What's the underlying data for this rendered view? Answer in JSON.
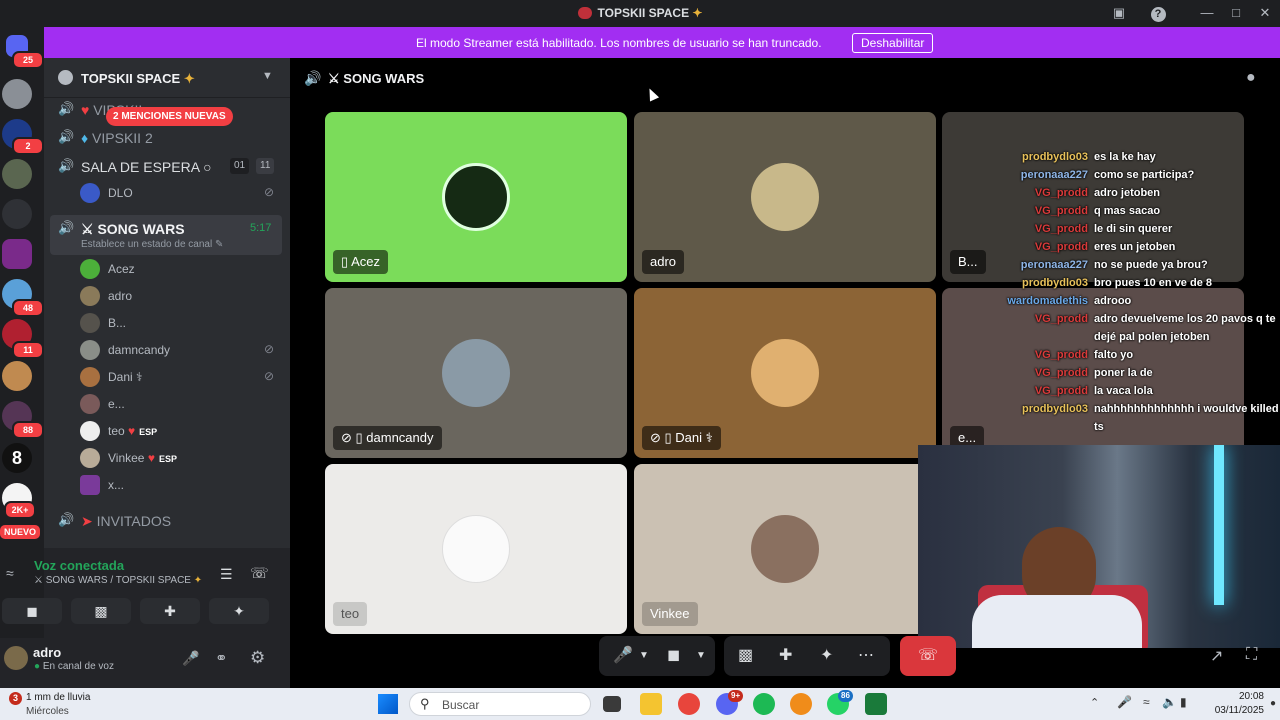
{
  "window": {
    "title": "TOPSKII SPACE"
  },
  "banner": {
    "text": "El modo Streamer está habilitado. Los nombres de usuario se han truncado.",
    "button": "Deshabilitar"
  },
  "rail": {
    "badges": [
      "25",
      "2",
      "48",
      "11",
      "88",
      "2K+",
      "NUEVO"
    ]
  },
  "guild": {
    "name": "TOPSKII SPACE"
  },
  "mentions": "2 MENCIONES NUEVAS",
  "channels": {
    "vips1": "VIPSKII",
    "vips2": "VIPSKII 2",
    "waiting": "SALA DE ESPERA",
    "waiting_counts": [
      "01",
      "11"
    ],
    "songwars": "SONG WARS",
    "songwars_timer": "5:17",
    "songwars_status": "Establece un estado de canal",
    "invitados": "INVITADOS"
  },
  "waiting_users": [
    "DLO"
  ],
  "members": [
    {
      "name": "Acez",
      "tag": "",
      "muted": false
    },
    {
      "name": "adro",
      "tag": "",
      "muted": false
    },
    {
      "name": "B...",
      "tag": "",
      "muted": false
    },
    {
      "name": "damncandy",
      "tag": "",
      "muted": true
    },
    {
      "name": "Dani ⚕",
      "tag": "",
      "muted": true
    },
    {
      "name": "e...",
      "tag": "",
      "muted": false
    },
    {
      "name": "teo",
      "tag": "ESP",
      "muted": false
    },
    {
      "name": "Vinkee",
      "tag": "ESP",
      "muted": false
    },
    {
      "name": "x...",
      "tag": "",
      "muted": false
    }
  ],
  "voice": {
    "status": "Voz conectada",
    "location": "SONG WARS / TOPSKII SPACE"
  },
  "me": {
    "name": "adro",
    "status": "En canal de voz"
  },
  "header": {
    "channel": "SONG WARS"
  },
  "tiles": [
    {
      "name": "Acez",
      "color": "#7bdc5a"
    },
    {
      "name": "adro",
      "color": "#5f5949"
    },
    {
      "name": "B...",
      "color": "#3d3a36"
    },
    {
      "name": "damncandy",
      "color": "#6a665e"
    },
    {
      "name": "Dani ⚕",
      "color": "#8c6436"
    },
    {
      "name": "e...",
      "color": "#5b4c4a"
    },
    {
      "name": "teo",
      "color": "#ecebe9"
    },
    {
      "name": "Vinkee",
      "color": "#cbc1b3"
    }
  ],
  "chat": [
    {
      "user": "prodbydlo03",
      "text": "es la ke hay",
      "color": "#e8c15a"
    },
    {
      "user": "peronaaa227",
      "text": "como se participa?",
      "color": "#8fb6e8"
    },
    {
      "user": "VG_prodd",
      "text": "adro jetoben",
      "color": "#d93a3a"
    },
    {
      "user": "VG_prodd",
      "text": "q mas sacao",
      "color": "#d93a3a"
    },
    {
      "user": "VG_prodd",
      "text": "le di sin querer",
      "color": "#d93a3a"
    },
    {
      "user": "VG_prodd",
      "text": "eres un jetoben",
      "color": "#d93a3a"
    },
    {
      "user": "peronaaa227",
      "text": "no se puede ya brou?",
      "color": "#8fb6e8"
    },
    {
      "user": "prodbydlo03",
      "text": "bro pues 10 en ve de 8",
      "color": "#e8c15a"
    },
    {
      "user": "wardomadethis",
      "text": "adrooo",
      "color": "#6aa8e8"
    },
    {
      "user": "VG_prodd",
      "text": "adro devuelveme los 20 pavos q te dejé pal polen jetoben",
      "color": "#d93a3a"
    },
    {
      "user": "VG_prodd",
      "text": "falto yo",
      "color": "#d93a3a"
    },
    {
      "user": "VG_prodd",
      "text": "poner la de",
      "color": "#d93a3a"
    },
    {
      "user": "VG_prodd",
      "text": "la vaca lola",
      "color": "#d93a3a"
    },
    {
      "user": "prodbydlo03",
      "text": "nahhhhhhhhhhhhh i wouldve killed ts",
      "color": "#e8c15a"
    }
  ],
  "taskbar": {
    "weather": "1 mm de lluvia",
    "weather_day": "Miércoles",
    "weather_badge": "3",
    "search": "Buscar",
    "time": "20:08",
    "date": "03/11/2025",
    "discord_badge": "9+",
    "whatsapp_badge": "86"
  }
}
